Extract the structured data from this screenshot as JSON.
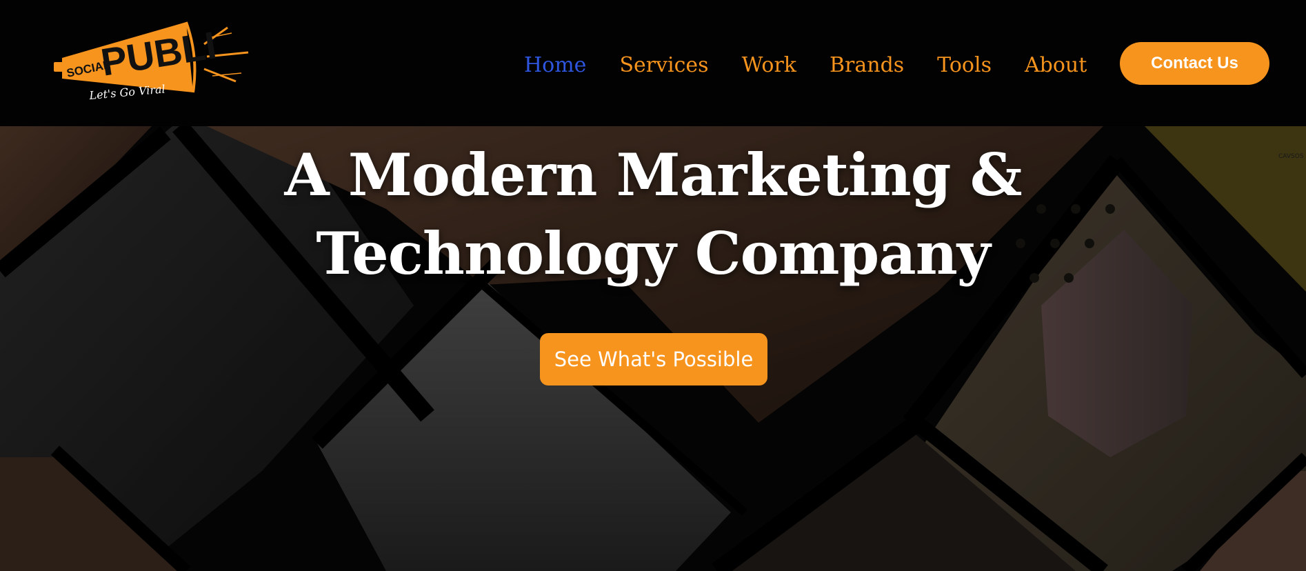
{
  "brand": {
    "logo_word_small": "SOCIAL",
    "logo_word_large": "PUBLI",
    "tagline": "Let's Go Viral",
    "accent_color": "#f7941d"
  },
  "nav": {
    "items": [
      {
        "label": "Home",
        "active": true
      },
      {
        "label": "Services",
        "active": false
      },
      {
        "label": "Work",
        "active": false
      },
      {
        "label": "Brands",
        "active": false
      },
      {
        "label": "Tools",
        "active": false
      },
      {
        "label": "About",
        "active": false
      }
    ],
    "active_color": "#2f56e0",
    "contact_label": "Contact Us"
  },
  "hero": {
    "title_line1": "A Modern Marketing &",
    "title_line2": "Technology Company",
    "cta_label": "See What's Possible",
    "photo_corner_text": "CAVSOS"
  }
}
